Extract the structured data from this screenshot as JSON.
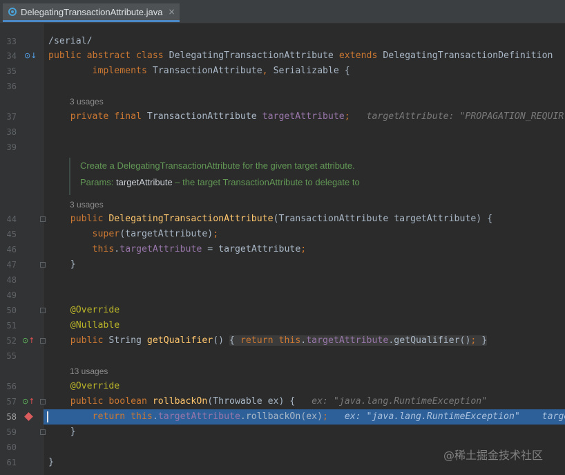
{
  "tab": {
    "filename": "DelegatingTransactionAttribute.java",
    "close": "×"
  },
  "code": {
    "top_faint": "/serial/",
    "serial": "/serial/",
    "line_33": "33",
    "line_34": "34",
    "line_35": "35",
    "line_36": "36",
    "line_37": "37",
    "line_38": "38",
    "line_39": "39",
    "line_44": "44",
    "line_45": "45",
    "line_46": "46",
    "line_47": "47",
    "line_48": "48",
    "line_49": "49",
    "line_50": "50",
    "line_51": "51",
    "line_52": "52",
    "line_55": "55",
    "line_56": "56",
    "line_57": "57",
    "line_58": "58",
    "line_59": "59",
    "line_60": "60",
    "line_61": "61",
    "usages_3a": "3 usages",
    "usages_3b": "3 usages",
    "usages_13": "13 usages",
    "doc_line1": "Create a DelegatingTransactionAttribute for the given target attribute.",
    "doc_params_label": "Params:",
    "doc_param_name": "targetAttribute",
    "doc_param_desc": " – the target TransactionAttribute to delegate to",
    "hint_37": "targetAttribute: \"PROPAGATION_REQUIR",
    "hint_57": "ex: \"java.lang.RuntimeException\"",
    "hint_58": "ex: \"java.lang.RuntimeException\"",
    "hint_58_tail": "targe"
  },
  "watermark": "@稀土掘金技术社区"
}
